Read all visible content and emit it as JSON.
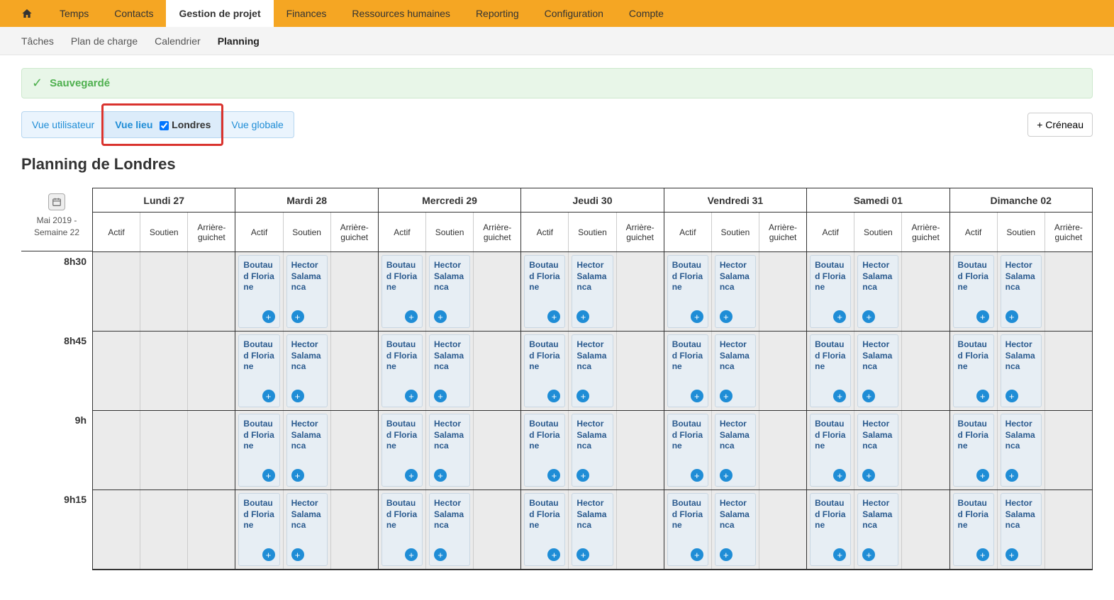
{
  "nav": {
    "tabs": [
      "Temps",
      "Contacts",
      "Gestion de projet",
      "Finances",
      "Ressources humaines",
      "Reporting",
      "Configuration",
      "Compte"
    ],
    "active": "Gestion de projet"
  },
  "subnav": {
    "tabs": [
      "Tâches",
      "Plan de charge",
      "Calendrier",
      "Planning"
    ],
    "active": "Planning"
  },
  "alert": {
    "text": "Sauvegardé"
  },
  "viewbar": {
    "user": "Vue utilisateur",
    "place": "Vue lieu",
    "location": "Londres",
    "global": "Vue globale"
  },
  "create_button": "+ Créneau",
  "page_title": "Planning de Londres",
  "timecol": {
    "period": "Mai 2019 - Semaine 22",
    "slots": [
      "8h30",
      "8h45",
      "9h",
      "9h15"
    ]
  },
  "subcols": [
    "Actif",
    "Soutien",
    "Arrière-guichet"
  ],
  "days": [
    "Lundi 27",
    "Mardi 28",
    "Mercredi 29",
    "Jeudi 30",
    "Vendredi 31",
    "Samedi 01",
    "Dimanche 02"
  ],
  "entries": {
    "actif_name": "Boutaud Floriane",
    "soutien_name": "Hector Salamanca"
  }
}
